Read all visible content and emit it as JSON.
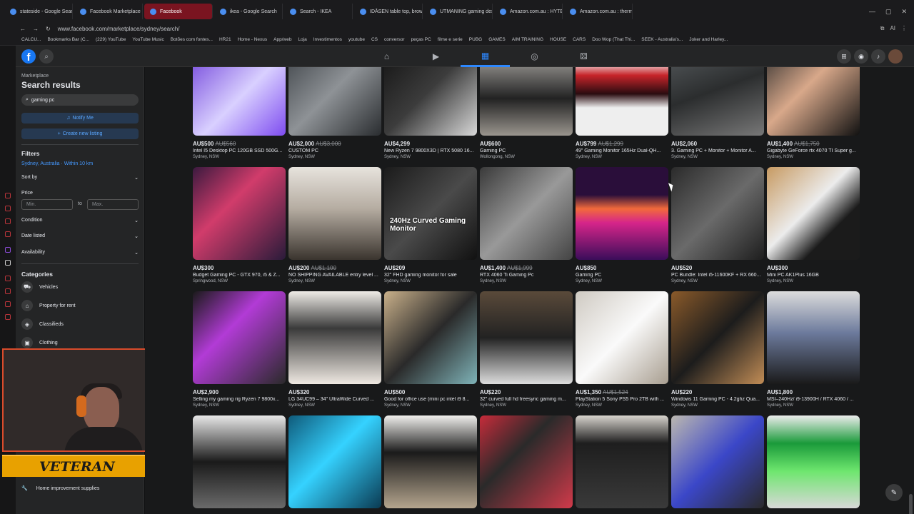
{
  "browser": {
    "tabs": [
      {
        "label": "stateside - Google Search",
        "active": false
      },
      {
        "label": "Facebook Marketplace | Fa",
        "active": false
      },
      {
        "label": "Facebook",
        "active": true
      },
      {
        "label": "ikea - Google Search",
        "active": false
      },
      {
        "label": "Search - IKEA",
        "active": false
      },
      {
        "label": "IDÅSEN table top, brown, 1",
        "active": false
      },
      {
        "label": "UTMANING gaming desk",
        "active": false
      },
      {
        "label": "Amazon.com.au : HYTE H",
        "active": false
      },
      {
        "label": "Amazon.com.au : thermalt",
        "active": false
      }
    ],
    "url": "www.facebook.com/marketplace/sydney/search/",
    "bookmarks": [
      "CALCU...",
      "Bookmarks Bar (C...",
      "(229) YouTube",
      "YouTube Music",
      "Botões com fontes...",
      "HR21",
      "Home - Nexus",
      "App/web",
      "Loja",
      "Investimentos",
      "youtube",
      "CS",
      "conversor",
      "peças PC",
      "filme e serie",
      "PUBG",
      "GAMES",
      "AIM TRAINING",
      "HOUSE",
      "CARS",
      "Doo Wop (That Thi...",
      "SEEK - Australia's...",
      "Joker and Harley..."
    ],
    "ai_label": "AI"
  },
  "fb": {
    "logo": "f",
    "nav": [
      {
        "name": "home-icon",
        "glyph": "⌂"
      },
      {
        "name": "video-icon",
        "glyph": "▶"
      },
      {
        "name": "marketplace-icon",
        "glyph": "▦"
      },
      {
        "name": "groups-icon",
        "glyph": "◎"
      },
      {
        "name": "gaming-icon",
        "glyph": "⚄"
      }
    ]
  },
  "sidebar": {
    "breadcrumb": "Marketplace",
    "title": "Search results",
    "search_value": "gaming pc",
    "notify_label": "Notify Me",
    "create_label": "Create new listing",
    "filters_title": "Filters",
    "location": "Sydney, Australia · Within 10 km",
    "sort_label": "Sort by",
    "price_label": "Price",
    "min_placeholder": "Min.",
    "to_label": "to",
    "max_placeholder": "Max.",
    "condition_label": "Condition",
    "date_label": "Date listed",
    "availability_label": "Availability",
    "categories_title": "Categories",
    "categories": [
      {
        "label": "Vehicles",
        "icon": "car-icon"
      },
      {
        "label": "Property for rent",
        "icon": "house-icon"
      },
      {
        "label": "Classifieds",
        "icon": "tag-icon"
      },
      {
        "label": "Clothing",
        "icon": "shirt-icon"
      }
    ],
    "home_improvement": "Home improvement supplies"
  },
  "overlay": {
    "banner_text": "VETERAN"
  },
  "listings": [
    {
      "price": "AU$500",
      "old": "AU$560",
      "title": "Intel I5 Desktop PC 120GB SSD 500G...",
      "loc": "Sydney, NSW",
      "bg": "linear-gradient(135deg,#6a3ad8,#d9d0ff 55%,#7e4cf0)"
    },
    {
      "price": "AU$2,000",
      "old": "AU$3,000",
      "title": "CUSTOM PC",
      "loc": "Sydney, NSW",
      "bg": "linear-gradient(135deg,#3a3f44,#8e9296 50%,#2a2d30)"
    },
    {
      "price": "AU$4,299",
      "old": "",
      "title": "New Ryzen 7 9800X3D | RTX 5080 16...",
      "loc": "Sydney, NSW",
      "bg": "linear-gradient(135deg,#111,#3c3c3c 50%,#d8d8d8)"
    },
    {
      "price": "AU$600",
      "old": "",
      "title": "Gaming PC",
      "loc": "Wollongong, NSW",
      "bg": "linear-gradient(180deg,#c9c6c1,#222 60%,#9a958e)"
    },
    {
      "price": "AU$799",
      "old": "AU$1,299",
      "title": "49\" Gaming Monitor 165Hz Dual-QH...",
      "loc": "Sydney, NSW",
      "bg": "linear-gradient(180deg,#f2f2f2 20%,#c7242a 35%,#2a0c10 55%,#eeeeee 70%)"
    },
    {
      "price": "AU$2,060",
      "old": "",
      "title": "3. Gaming PC + Monitor + Monitor A...",
      "loc": "Sydney, NSW",
      "bg": "linear-gradient(160deg,#5a5f62,#2b2d2e 50%,#777)"
    },
    {
      "price": "AU$1,400",
      "old": "AU$1,750",
      "title": "Gigabyte GeForce rtx 4070 TI Super g...",
      "loc": "Sydney, NSW",
      "bg": "linear-gradient(135deg,#2a2a2a,#d8a88a 45%,#111)"
    },
    {
      "price": "AU$300",
      "old": "",
      "title": "Budget Gaming PC - GTX 970, i5 & Z...",
      "loc": "Springwood, NSW",
      "bg": "linear-gradient(135deg,#3b1a3f,#d13c6b 40%,#2a1b3a)"
    },
    {
      "price": "AU$200",
      "old": "AU$1,100",
      "title": "NO SHIPPING AVAILABLE entry level ...",
      "loc": "Sydney, NSW",
      "bg": "linear-gradient(180deg,#e7e3dd,#b5aca1 45%,#3a342e)"
    },
    {
      "price": "AU$209",
      "old": "",
      "title": "32\" FHD gaming monitor for sale",
      "loc": "Sydney, NSW",
      "bg": "linear-gradient(135deg,#1b1b1b,#4a4a4a 50%,#111)",
      "overlay": "240Hz Curved Gaming Monitor"
    },
    {
      "price": "AU$1,400",
      "old": "AU$1,999",
      "title": "RTX 4060 Ti Gaming Pc",
      "loc": "Sydney, NSW",
      "bg": "linear-gradient(135deg,#3a3a3a,#999 50%,#444)"
    },
    {
      "price": "AU$850",
      "old": "",
      "title": "Gaming PC",
      "loc": "Sydney, NSW",
      "bg": "linear-gradient(180deg,#2a0e3a 30%,#f26a3b 45%,#d6258a 60%,#3a0d5a)"
    },
    {
      "price": "AU$520",
      "old": "",
      "title": "PC Bundle: Intel i5-11600KF + RX 660...",
      "loc": "Sydney, NSW",
      "bg": "linear-gradient(135deg,#2b2b2b,#6a6a6a 50%,#1e1e1e)"
    },
    {
      "price": "AU$300",
      "old": "",
      "title": "Mini PC AK1Plus 16GB",
      "loc": "Sydney, NSW",
      "bg": "linear-gradient(135deg,#c79a62,#ececec 45%,#1b1b1b 70%)"
    },
    {
      "price": "AU$2,900",
      "old": "",
      "title": "Selling my gaming rig Ryzen 7 9800x...",
      "loc": "Sydney, NSW",
      "bg": "linear-gradient(135deg,#1a1a1a,#b23bd6 40%,#2a2a2a)"
    },
    {
      "price": "AU$320",
      "old": "",
      "title": "LG 34UC99 – 34\" UltraWide Curved ...",
      "loc": "Sydney, NSW",
      "bg": "linear-gradient(180deg,#efece7,#3a3a3a 40%,#efe9e2)"
    },
    {
      "price": "AU$500",
      "old": "",
      "title": "Good for office use (mini pc intel i9 8...",
      "loc": "Sydney, NSW",
      "bg": "linear-gradient(135deg,#c9b08a,#2a2a2a 50%,#7fb3b8)"
    },
    {
      "price": "AU$220",
      "old": "",
      "title": "32\" curved full hd freesync gaming m...",
      "loc": "Sydney, NSW",
      "bg": "linear-gradient(180deg,#5a4a3a,#222 50%,#ddd)"
    },
    {
      "price": "AU$1,350",
      "old": "AU$1,524",
      "title": "PlayStation 5 Sony PS5 Pro 2TB with ...",
      "loc": "Sydney, NSW",
      "bg": "linear-gradient(135deg,#cfcac2,#fafafa 50%,#a89e90)"
    },
    {
      "price": "AU$220",
      "old": "",
      "title": "Windows 11 Gaming PC - 4.2ghz Qua...",
      "loc": "Sydney, NSW",
      "bg": "linear-gradient(135deg,#8a5a2a,#1c1c1c 50%,#c28d56)"
    },
    {
      "price": "AU$1,800",
      "old": "",
      "title": "MSI–240Hz/ i9-13900H / RTX 4060 / ...",
      "loc": "Sydney, NSW",
      "bg": "linear-gradient(180deg,#dcdcdc,#6c7a9c 45%,#1a1a1a)"
    },
    {
      "price": "",
      "old": "",
      "title": "",
      "loc": "",
      "bg": "linear-gradient(180deg,#e8e8e8,#1a1a1a 50%,#6a6a6a)"
    },
    {
      "price": "",
      "old": "",
      "title": "",
      "loc": "",
      "bg": "linear-gradient(135deg,#0f5a7a,#35d2ff 45%,#0a3a52)"
    },
    {
      "price": "",
      "old": "",
      "title": "",
      "loc": "",
      "bg": "linear-gradient(180deg,#f0efec,#1a1a1a 40%,#b5a58e)"
    },
    {
      "price": "",
      "old": "",
      "title": "",
      "loc": "",
      "bg": "linear-gradient(135deg,#c62b3a,#2a2a2a 40%,#d13a4a)"
    },
    {
      "price": "",
      "old": "",
      "title": "",
      "loc": "",
      "bg": "linear-gradient(180deg,#d8d4ce,#1e1e1e 30%,#3a3a3a)"
    },
    {
      "price": "",
      "old": "",
      "title": "",
      "loc": "",
      "bg": "linear-gradient(135deg,#bcb8b0,#3b47c8 50%,#2a2a2a)"
    },
    {
      "price": "",
      "old": "",
      "title": "",
      "loc": "",
      "bg": "linear-gradient(180deg,#ececec,#1a9a3a 30%,#6ee66e 60%,#d8d8d8)"
    }
  ]
}
